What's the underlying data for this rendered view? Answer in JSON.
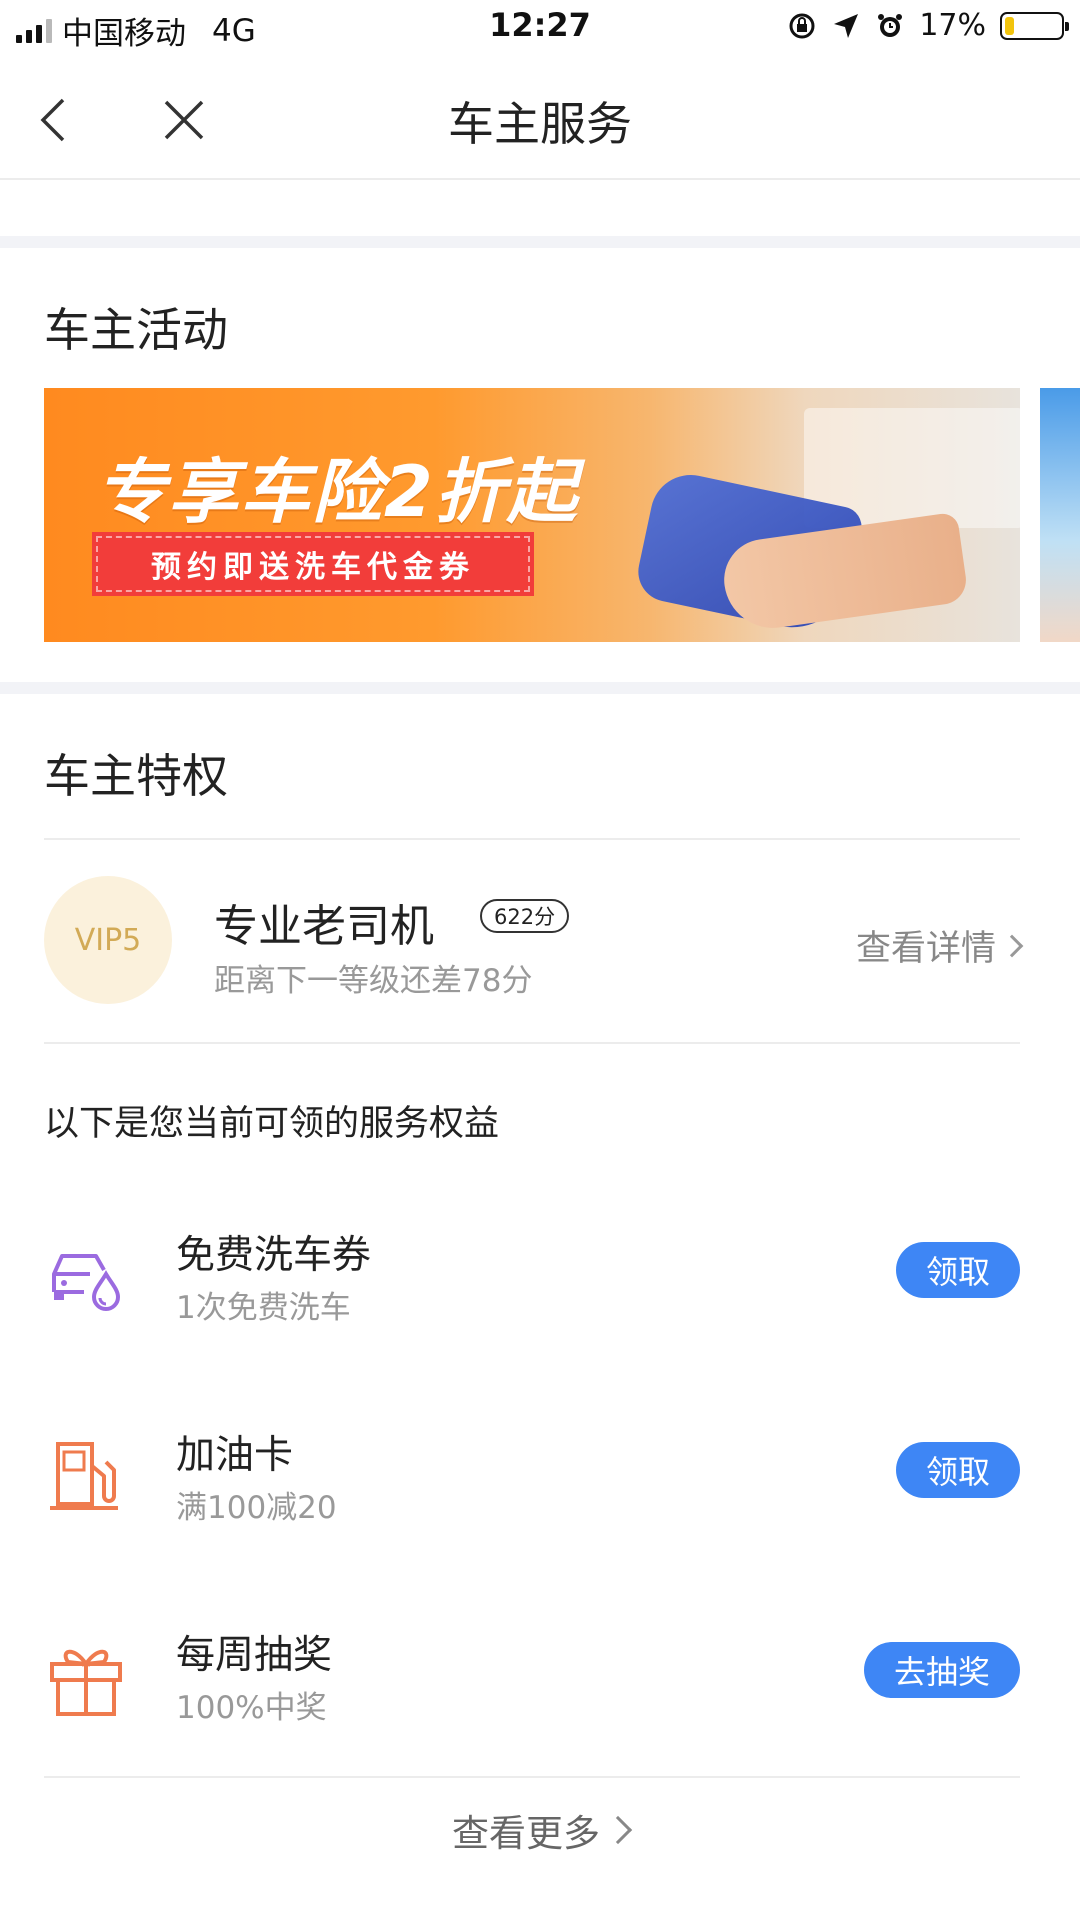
{
  "status_bar": {
    "carrier": "中国移动",
    "network": "4G",
    "time": "12:27",
    "battery": "17%",
    "battery_level": 0.17,
    "icons": [
      "rotation-lock-icon",
      "location-arrow-icon",
      "alarm-icon"
    ]
  },
  "nav": {
    "title": "车主服务",
    "back_icon": "chevron-left-icon",
    "close_icon": "close-icon"
  },
  "activities": {
    "title": "车主活动",
    "banner": {
      "headline": "专享车险2折起",
      "subline": "预约即送洗车代金券"
    }
  },
  "privileges": {
    "title": "车主特权",
    "vip": {
      "badge": "VIP5",
      "level_name": "专业老司机",
      "score": "622分",
      "progress_text": "距离下一等级还差78分",
      "detail_link": "查看详情"
    },
    "intro": "以下是您当前可领的服务权益",
    "benefits": [
      {
        "icon": "car-wash-icon",
        "name": "免费洗车券",
        "desc": "1次免费洗车",
        "action": "领取"
      },
      {
        "icon": "fuel-pump-icon",
        "name": "加油卡",
        "desc": "满100减20",
        "action": "领取"
      },
      {
        "icon": "gift-icon",
        "name": "每周抽奖",
        "desc": "100%中奖",
        "action": "去抽奖"
      }
    ],
    "more_link": "查看更多"
  },
  "colors": {
    "accent_blue": "#3e86f5",
    "vip_gold": "#d2aa56",
    "vip_bg": "#fbf1dc",
    "icon_purple": "#9b6be0",
    "icon_orange": "#ef7b4e"
  }
}
